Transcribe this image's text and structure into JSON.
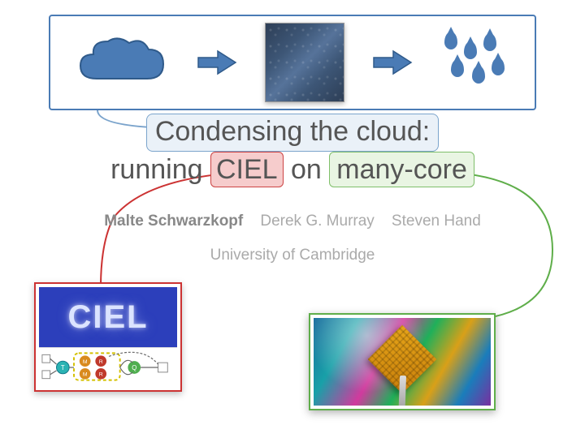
{
  "banner": {
    "items": [
      "cloud",
      "arrow",
      "condensation-pane",
      "arrow",
      "raindrops"
    ]
  },
  "title": {
    "line1": "Condensing the cloud:",
    "line2_prefix": "running ",
    "ciel": "CIEL",
    "line2_mid": " on ",
    "manycore": "many-core"
  },
  "authors": {
    "presenter": "Malte Schwarzkopf",
    "a2": "Derek G. Murray",
    "a3": "Steven Hand"
  },
  "affiliation": "University of Cambridge",
  "ciel_logo_text": "CIEL",
  "colors": {
    "blue": "#4a7bb5",
    "red": "#c33",
    "green": "#5fae4a"
  }
}
